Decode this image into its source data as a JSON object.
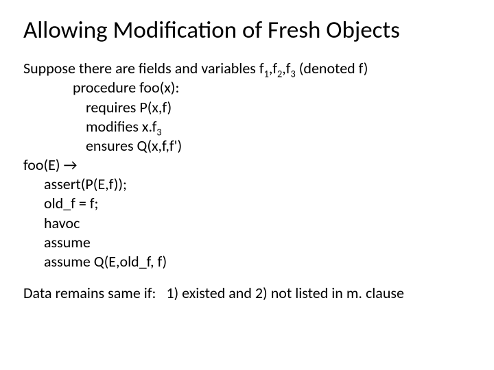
{
  "title": "Allowing Modification of Fresh Objects",
  "intro_a": "Suppose there are fields and variables f",
  "intro_b": ",f",
  "intro_c": ",f",
  "intro_d": " (denoted f)",
  "sub1": "1",
  "sub2": "2",
  "sub3": "3",
  "proc": "procedure foo(x):",
  "req": " requires P(x,f)",
  "mod_a": " modifies x.f",
  "ens": " ensures Q(x,f,f')",
  "call": "foo(E) →",
  "l1": "assert(P(E,f));",
  "l2": "old_f = f;",
  "l3": "havoc",
  "l4": "assume",
  "l5": "assume Q(E,old_f, f)",
  "footer": "Data remains same if:   1) existed and 2) not listed in m. clause"
}
